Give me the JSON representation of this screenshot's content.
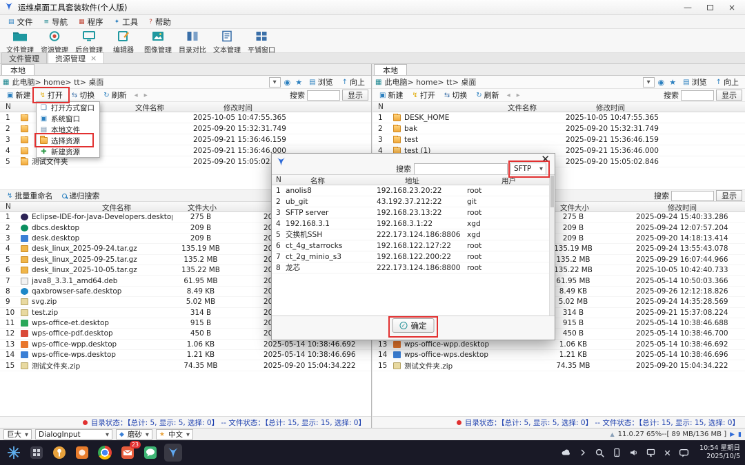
{
  "window": {
    "title": "运维桌面工具套装软件(个人版)"
  },
  "menubar": {
    "items": [
      {
        "label": "文件"
      },
      {
        "label": "导航"
      },
      {
        "label": "程序"
      },
      {
        "label": "工具"
      },
      {
        "label": "帮助"
      }
    ]
  },
  "toolbar": {
    "items": [
      {
        "label": "文件管理"
      },
      {
        "label": "资源管理"
      },
      {
        "label": "后台管理"
      },
      {
        "label": "编辑器"
      },
      {
        "label": "图像管理"
      },
      {
        "label": "目录对比"
      },
      {
        "label": "文本管理"
      },
      {
        "label": "平铺窗口"
      }
    ]
  },
  "main_tabs": [
    {
      "label": "文件管理"
    },
    {
      "label": "资源管理"
    }
  ],
  "pane": {
    "local_tab": "本地",
    "breadcrumb": "此电脑> home> tt> 桌面",
    "browse": "浏览",
    "up": "向上",
    "new": "新建",
    "open": "打开",
    "switch": "切换",
    "refresh": "刷新",
    "search": "搜索",
    "show": "显示",
    "batch_rename": "批量重命名",
    "recursive_search": "递归搜索",
    "dir_headers": {
      "n": "N",
      "name": "文件名称",
      "date": "修改时间"
    },
    "file_headers": {
      "n": "N",
      "name": "文件名称",
      "size": "文件大小",
      "date": "修改时间"
    },
    "status": "目录状态：【总计: 5, 显示: 5, 选择: 0】 -- 文件状态：【总计: 15, 显示: 15, 选择: 0】"
  },
  "open_menu": {
    "items": [
      {
        "label": "打开方式窗口"
      },
      {
        "label": "系统窗口"
      },
      {
        "label": "本地文件"
      },
      {
        "label": "选择资源"
      },
      {
        "label": "新建资源"
      }
    ]
  },
  "left_pane": {
    "dirs": [
      {
        "n": "1",
        "name": "",
        "date": "2025-10-05 10:47:55.365"
      },
      {
        "n": "2",
        "name": "",
        "date": "2025-09-20 15:32:31.749"
      },
      {
        "n": "3",
        "name": "",
        "date": "2025-09-21 15:36:46.159"
      },
      {
        "n": "4",
        "name": "",
        "date": "2025-09-21 15:36:46.000"
      },
      {
        "n": "5",
        "name": "测试文件夹",
        "date": "2025-09-20 15:05:02.846"
      }
    ]
  },
  "right_pane": {
    "dirs": [
      {
        "n": "1",
        "name": "DESK_HOME",
        "date": "2025-10-05 10:47:55.365"
      },
      {
        "n": "2",
        "name": "bak",
        "date": "2025-09-20 15:32:31.749"
      },
      {
        "n": "3",
        "name": "test",
        "date": "2025-09-21 15:36:46.159"
      },
      {
        "n": "4",
        "name": "test (1)",
        "date": "2025-09-21 15:36:46.000"
      },
      {
        "n": "5",
        "name": "",
        "date": "2025-09-20 15:05:02.846"
      }
    ]
  },
  "files": [
    {
      "n": "1",
      "icon": "ic-eclipse",
      "name": "Eclipse-IDE-for-Java-Developers.desktop",
      "size": "275 B",
      "date": "2025-09-24 15:40:33.286"
    },
    {
      "n": "2",
      "icon": "ic-dbcs",
      "name": "dbcs.desktop",
      "size": "209 B",
      "date": "2025-09-24 12:07:57.204"
    },
    {
      "n": "3",
      "icon": "ic-desk",
      "name": "desk.desktop",
      "size": "209 B",
      "date": "2025-09-20 14:18:13.414"
    },
    {
      "n": "4",
      "icon": "ic-targz",
      "name": "desk_linux_2025-09-24.tar.gz",
      "size": "135.19 MB",
      "date": "2025-09-24 13:55:43.078"
    },
    {
      "n": "5",
      "icon": "ic-targz",
      "name": "desk_linux_2025-09-25.tar.gz",
      "size": "135.2 MB",
      "date": "2025-09-29 16:07:44.966"
    },
    {
      "n": "6",
      "icon": "ic-targz",
      "name": "desk_linux_2025-10-05.tar.gz",
      "size": "135.22 MB",
      "date": "2025-10-05 10:42:40.733"
    },
    {
      "n": "7",
      "icon": "ic-deb",
      "name": "java8_3.3.1_amd64.deb",
      "size": "61.95 MB",
      "date": "2025-05-14 10:50:03.366"
    },
    {
      "n": "8",
      "icon": "ic-browser",
      "name": "qaxbrowser-safe.desktop",
      "size": "8.49 KB",
      "date": "2025-09-26 12:12:18.826"
    },
    {
      "n": "9",
      "icon": "ic-zip",
      "name": "svg.zip",
      "size": "5.02 MB",
      "date": "2025-09-24 14:35:28.569"
    },
    {
      "n": "10",
      "icon": "ic-zip",
      "name": "test.zip",
      "size": "314 B",
      "date": "2025-09-21 15:37:08.224"
    },
    {
      "n": "11",
      "icon": "ic-wps-et",
      "name": "wps-office-et.desktop",
      "size": "915 B",
      "date": "2025-05-14 10:38:46.688"
    },
    {
      "n": "12",
      "icon": "ic-wps-pdf",
      "name": "wps-office-pdf.desktop",
      "size": "450 B",
      "date": "2025-05-14 10:38:46.700"
    },
    {
      "n": "13",
      "icon": "ic-wps-wpp",
      "name": "wps-office-wpp.desktop",
      "size": "1.06 KB",
      "date": "2025-05-14 10:38:46.692"
    },
    {
      "n": "14",
      "icon": "ic-wps-wps",
      "name": "wps-office-wps.desktop",
      "size": "1.21 KB",
      "date": "2025-05-14 10:38:46.696"
    },
    {
      "n": "15",
      "icon": "ic-zip",
      "name": "测试文件夹.zip",
      "size": "74.35 MB",
      "date": "2025-09-20 15:04:34.222"
    }
  ],
  "dialog": {
    "search_label": "搜索",
    "protocol": "SFTP",
    "headers": {
      "n": "N",
      "name": "名称",
      "addr": "地址",
      "user": "用户"
    },
    "rows": [
      {
        "n": "1",
        "name": "anolis8",
        "addr": "192.168.23.20:22",
        "user": "root"
      },
      {
        "n": "2",
        "name": "ub_git",
        "addr": "43.192.37.212:22",
        "user": "git"
      },
      {
        "n": "3",
        "name": "SFTP server",
        "addr": "192.168.23.13:22",
        "user": "root"
      },
      {
        "n": "4",
        "name": "192.168.3.1",
        "addr": "192.168.3.1:22",
        "user": "xgd"
      },
      {
        "n": "5",
        "name": "交换机SSH",
        "addr": "222.173.124.186:8806",
        "user": "xgd"
      },
      {
        "n": "6",
        "name": "ct_4g_starrocks",
        "addr": "192.168.122.127:22",
        "user": "root"
      },
      {
        "n": "7",
        "name": "ct_2g_minio_s3",
        "addr": "192.168.122.200:22",
        "user": "root"
      },
      {
        "n": "8",
        "name": "龙芯",
        "addr": "222.173.124.186:8800",
        "user": "root"
      }
    ],
    "ok": "确定"
  },
  "statusbar": {
    "font_size": "巨大",
    "font_name": "DialogInput",
    "theme": "磨砂",
    "language": "中文",
    "memory": "11.0.27 65%--[ 89 MB/136 MB ]"
  },
  "taskbar": {
    "mail_badge": "23",
    "clock_time": "10:54 星期日",
    "clock_date": "2025/10/5"
  }
}
